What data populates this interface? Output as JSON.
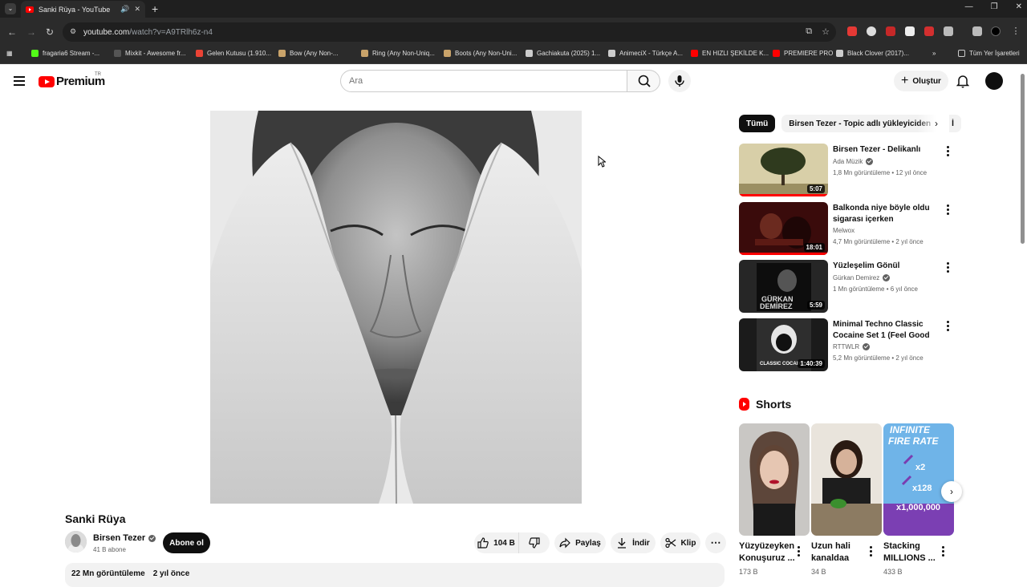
{
  "browser": {
    "tab_title": "Sanki Rüya - YouTube",
    "url_host": "youtube.com",
    "url_path": "/watch?v=A9TRlh6z-n4",
    "bookmarks": [
      {
        "label": "fragaria6 Stream -...",
        "color": "#53fc18"
      },
      {
        "label": "Mixkit - Awesome fr...",
        "color": "#222222"
      },
      {
        "label": "Gelen Kutusu (1.910...",
        "color": "#ea4335"
      },
      {
        "label": "Bow (Any Non-...",
        "color": "#c9a36a"
      },
      {
        "label": "Ring (Any Non-Uniq...",
        "color": "#c9a36a"
      },
      {
        "label": "Boots (Any Non-Uni...",
        "color": "#c9a36a"
      },
      {
        "label": "Gachiakuta (2025) 1...",
        "color": "#cccccc"
      },
      {
        "label": "AnimeciX - Türkçe A...",
        "color": "#cccccc"
      },
      {
        "label": "EN HIZLI ŞEKİLDE K...",
        "color": "#ff0000"
      },
      {
        "label": "PREMIERE PRO",
        "color": "#ff0000"
      },
      {
        "label": "Black Clover (2017)...",
        "color": "#cccccc"
      }
    ],
    "all_bookmarks": "Tüm Yer İşaretleri",
    "overflow": "»"
  },
  "header": {
    "logo_text": "Premium",
    "country": "TR",
    "search_placeholder": "Ara",
    "create_label": "Oluştur"
  },
  "video": {
    "title": "Sanki Rüya",
    "channel": "Birsen Tezer",
    "subscribers": "41 B abone",
    "subscribe_label": "Abone ol",
    "likes": "104 B",
    "share_label": "Paylaş",
    "download_label": "İndir",
    "clip_label": "Klip",
    "views": "22 Mn görüntüleme",
    "age": "2 yıl önce"
  },
  "chips": [
    "Tümü",
    "Birsen Tezer - Topic adlı yükleyiciden",
    "İ"
  ],
  "recommendations": [
    {
      "title": "Birsen Tezer - Delikanlı",
      "channel": "Ada Müzik",
      "verified": true,
      "meta": "1,8 Mn görüntüleme • 12 yıl önce",
      "duration": "5:07",
      "watched": 1.0
    },
    {
      "title": "Balkonda niye böyle oldu sigarası içerken dinlenilecek ...",
      "channel": "Melwox",
      "verified": false,
      "meta": "4,7 Mn görüntüleme • 2 yıl önce",
      "duration": "18:01",
      "watched": 1.0
    },
    {
      "title": "Yüzleşelim Gönül",
      "channel": "Gürkan Demirez",
      "verified": true,
      "meta": "1 Mn görüntüleme • 6 yıl önce",
      "duration": "5:59",
      "watched": 0
    },
    {
      "title": "Minimal Techno Classic Cocaine Set 1 (Feel Good Mix)",
      "channel": "RTTWLR",
      "verified": true,
      "meta": "5,2 Mn görüntüleme • 2 yıl önce",
      "duration": "1:40:39",
      "watched": 0
    }
  ],
  "shorts": {
    "heading": "Shorts",
    "items": [
      {
        "title": "Yüzyüzeyken Konuşuruz ...",
        "views": "173 B"
      },
      {
        "title": "Uzun hali kanaldaa",
        "views": "34 B"
      },
      {
        "title": "Stacking MILLIONS ...",
        "views": "433 B"
      }
    ]
  }
}
